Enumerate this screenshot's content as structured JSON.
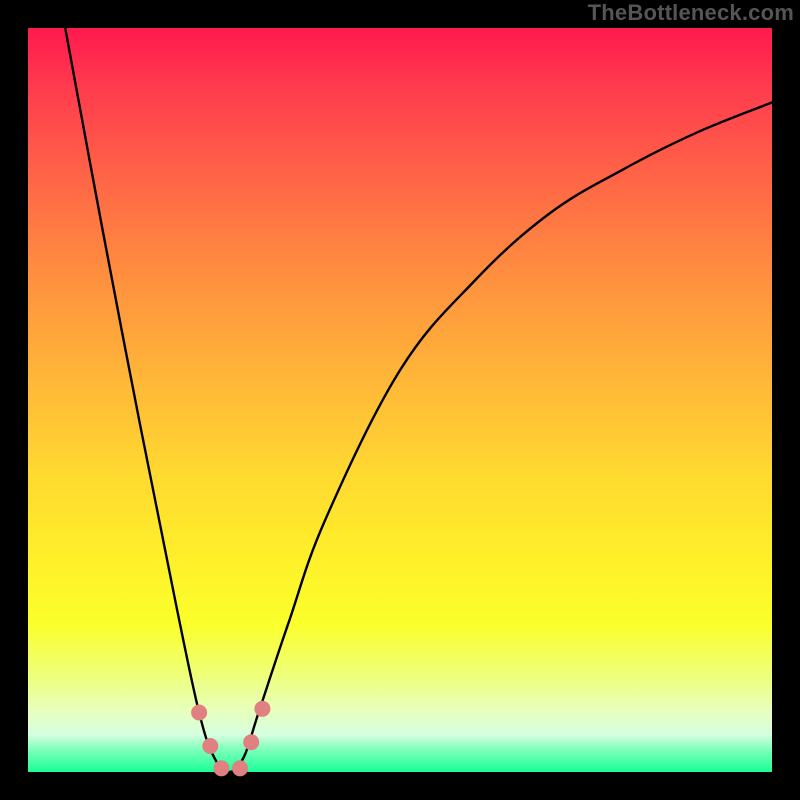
{
  "watermark": "TheBottleneck.com",
  "chart_data": {
    "type": "line",
    "title": "",
    "xlabel": "",
    "ylabel": "",
    "xlim": [
      0,
      100
    ],
    "ylim": [
      0,
      100
    ],
    "minimum_x": 27,
    "series": [
      {
        "name": "bottleneck-curve",
        "x": [
          5,
          10,
          15,
          20,
          23,
          25,
          27,
          29,
          31,
          35,
          40,
          50,
          60,
          70,
          80,
          90,
          100
        ],
        "y": [
          100,
          73,
          47,
          22,
          8,
          2,
          0,
          2,
          8,
          20,
          34,
          54,
          66,
          75,
          81,
          86,
          90
        ]
      }
    ],
    "markers": [
      {
        "name": "marker-left-upper",
        "x": 23.0,
        "y": 8.0
      },
      {
        "name": "marker-left-lower",
        "x": 24.5,
        "y": 3.5
      },
      {
        "name": "marker-min-left",
        "x": 26.0,
        "y": 0.5
      },
      {
        "name": "marker-min-right",
        "x": 28.5,
        "y": 0.5
      },
      {
        "name": "marker-right-lower",
        "x": 30.0,
        "y": 4.0
      },
      {
        "name": "marker-right-upper",
        "x": 31.5,
        "y": 8.5
      }
    ],
    "marker_color": "#e08080",
    "curve_color": "#000000"
  }
}
